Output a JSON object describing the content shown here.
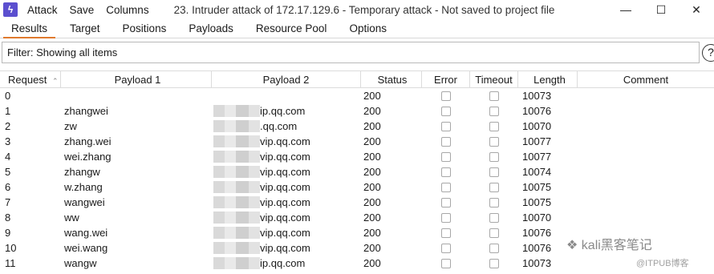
{
  "menu": {
    "items": [
      "Attack",
      "Save",
      "Columns"
    ]
  },
  "window": {
    "title": "23. Intruder attack of 172.17.129.6 - Temporary attack - Not saved to project file"
  },
  "tabs": [
    "Results",
    "Target",
    "Positions",
    "Payloads",
    "Resource Pool",
    "Options"
  ],
  "filter": {
    "text": "Filter: Showing all items",
    "help_label": "?"
  },
  "columns": {
    "request": "Request",
    "payload1": "Payload 1",
    "payload2": "Payload 2",
    "status": "Status",
    "error": "Error",
    "timeout": "Timeout",
    "length": "Length",
    "comment": "Comment"
  },
  "rows": [
    {
      "request": "0",
      "payload1": "",
      "payload2": "",
      "status": "200",
      "length": "10073"
    },
    {
      "request": "1",
      "payload1": "zhangwei",
      "payload2": "ip.qq.com",
      "status": "200",
      "length": "10076"
    },
    {
      "request": "2",
      "payload1": "zw",
      "payload2": ".qq.com",
      "status": "200",
      "length": "10070"
    },
    {
      "request": "3",
      "payload1": "zhang.wei",
      "payload2": "vip.qq.com",
      "status": "200",
      "length": "10077"
    },
    {
      "request": "4",
      "payload1": "wei.zhang",
      "payload2": "vip.qq.com",
      "status": "200",
      "length": "10077"
    },
    {
      "request": "5",
      "payload1": "zhangw",
      "payload2": "vip.qq.com",
      "status": "200",
      "length": "10074"
    },
    {
      "request": "6",
      "payload1": "w.zhang",
      "payload2": "vip.qq.com",
      "status": "200",
      "length": "10075"
    },
    {
      "request": "7",
      "payload1": "wangwei",
      "payload2": "vip.qq.com",
      "status": "200",
      "length": "10075"
    },
    {
      "request": "8",
      "payload1": "ww",
      "payload2": "vip.qq.com",
      "status": "200",
      "length": "10070"
    },
    {
      "request": "9",
      "payload1": "wang.wei",
      "payload2": "vip.qq.com",
      "status": "200",
      "length": "10076"
    },
    {
      "request": "10",
      "payload1": "wei.wang",
      "payload2": "vip.qq.com",
      "status": "200",
      "length": "10076"
    },
    {
      "request": "11",
      "payload1": "wangw",
      "payload2": "ip.qq.com",
      "status": "200",
      "length": "10073"
    }
  ],
  "watermark": {
    "line1": "kali黑客笔记",
    "line2": "@ITPUB博客"
  },
  "colors": {
    "accent": "#e07a2e",
    "app_icon": "#5b4fcf"
  }
}
